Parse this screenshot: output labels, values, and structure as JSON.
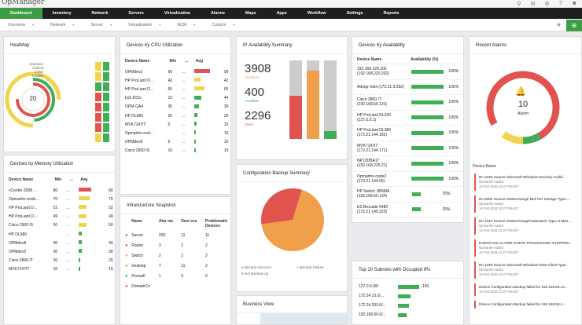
{
  "app": {
    "logo": "OpManager"
  },
  "nav": {
    "items": [
      "Dashboard",
      "Inventory",
      "Network",
      "Servers",
      "Virtualization",
      "Alarms",
      "Maps",
      "Apps",
      "Workflow",
      "Settings",
      "Reports"
    ],
    "active": 0
  },
  "subnav": {
    "items": [
      "Overview",
      "Network",
      "Server",
      "Virtualization",
      "NCM",
      "Custom"
    ]
  },
  "heatmap": {
    "title": "HeatMap",
    "legend": [
      "Attention",
      "Critical",
      "Clear",
      "Trouble"
    ],
    "center_value": "20"
  },
  "cpu": {
    "title": "Devices by CPU Utilization",
    "headers": [
      "Device Name",
      "Min",
      "...",
      "Avg"
    ],
    "rows": [
      {
        "name": "OPMdev2",
        "min": "99",
        "dot": "...",
        "avg": "99",
        "pct": 99,
        "color": "#e0534f"
      },
      {
        "name": "HP ProLiant D...",
        "min": "42",
        "dot": "...",
        "avg": "42",
        "pct": 42,
        "color": "#f0d44e"
      },
      {
        "name": "HP ProLiant D...",
        "min": "65",
        "dot": "...",
        "avg": "65",
        "pct": 65,
        "color": "#f0d44e"
      },
      {
        "name": "k16-DCtv",
        "min": "10",
        "dot": "...",
        "avg": "44",
        "pct": 44,
        "color": "#3fae57"
      },
      {
        "name": "OPM-QA4",
        "min": "30",
        "dot": "...",
        "avg": "30",
        "pct": 30,
        "color": "#3fae57"
      },
      {
        "name": "HP DL580",
        "min": "20",
        "dot": "...",
        "avg": "20",
        "pct": 20,
        "color": "#3fae57"
      },
      {
        "name": "MVK7147IT",
        "min": "5",
        "dot": "...",
        "avg": "15",
        "pct": 15,
        "color": "#3fae57"
      },
      {
        "name": "Opmanhv-nod...",
        "min": "",
        "dot": "...",
        "avg": "10",
        "pct": 10,
        "color": "#3fae57"
      },
      {
        "name": "OPMdev8",
        "min": "5",
        "dot": "...",
        "avg": "10",
        "pct": 10,
        "color": "#3fae57"
      },
      {
        "name": "Cisco 2900 IS",
        "min": "10",
        "dot": "...",
        "avg": "10",
        "pct": 10,
        "color": "#3fae57"
      }
    ]
  },
  "ipavail": {
    "title": "IP Availability Summary",
    "stats": [
      {
        "value": "3908",
        "label": "Transient",
        "color": "#f0a04b"
      },
      {
        "value": "400",
        "label": "Available",
        "color": "#3fae57"
      },
      {
        "value": "2296",
        "label": "Used",
        "color": "#e0534f"
      }
    ],
    "bars": [
      {
        "total": 100,
        "fill": 55,
        "color": "#e0534f"
      },
      {
        "total": 100,
        "fill": 87,
        "color": "#f0a04b"
      },
      {
        "total": 100,
        "fill": 10,
        "color": "#3fae57"
      }
    ]
  },
  "availability": {
    "title": "Devices by Availability",
    "headers": [
      "Device Name",
      "Availability (%)"
    ],
    "rows": [
      {
        "name": "192.168.220.202",
        "sub": "(192.168.220.202)",
        "value": "100%",
        "pct": 100
      },
      {
        "name": "Admgr-mbx (172.21.9.252)",
        "sub": "",
        "value": "100%",
        "pct": 100
      },
      {
        "name": "Cisco 2800 IT",
        "sub": "(192.168.50.131)",
        "value": "100%",
        "pct": 100
      },
      {
        "name": "HP ProLiant DL325",
        "sub": "(127.0.0.1)",
        "value": "100%",
        "pct": 100
      },
      {
        "name": "HP ProLiant DL380",
        "sub": "(172.21.144.182)",
        "value": "100%",
        "pct": 100
      },
      {
        "name": "MVK7147IT",
        "sub": "(172.21.144.171)",
        "value": "100%",
        "pct": 100
      },
      {
        "name": "NP12DBA17",
        "sub": "(192.168.225.21)",
        "value": "100%",
        "pct": 100
      },
      {
        "name": "Opmanhv-node2",
        "sub": "(172.21.144.65)",
        "value": "100%",
        "pct": 100
      },
      {
        "name": "HP Switch J8698A",
        "sub": "(192.168.50.134)",
        "value": "25%",
        "pct": 25
      },
      {
        "name": "ES Brocade 5480",
        "sub": "(172.21.149.223)",
        "value": "25%",
        "pct": 25
      }
    ]
  },
  "alarms": {
    "title": "Recent Alarms",
    "count": "10",
    "label": "Alarm",
    "col": "Device Name",
    "items": [
      {
        "title": "ID=4425 Source=Microsoft-Windows-Security-Auditi...",
        "src": "Opmanhv-node2",
        "date": "14 Feb 2019 12:27 PM IST"
      },
      {
        "title": "ID=6002 Source=MSExchange Mid-Tier Storage Type=...",
        "src": "Opmanhv-node2",
        "date": "14 Feb 2019 12:27 PM IST"
      },
      {
        "title": "ID=1010 Source=MSExchangeFastSearch Type=2 Mes...",
        "src": "Opmanhv-node2",
        "date": "14 Feb 2019 12:27 PM IST"
      },
      {
        "title": "EVENTLOG ALARM: EVENT PROCESSING STOPPED...",
        "src": "Opmanhv-node2",
        "date": "14 Feb 2019 12:27 PM IST"
      },
      {
        "title": "ID=1054 Source=Microsoft-Windows-DNS-Client Type...",
        "src": "Opmanhv-node2",
        "date": "14 Feb 2019 12:27 PM IST"
      },
      {
        "title": "Device Configuration Backup failed for 192.168.50.14...",
        "src": "",
        "date": "14 Feb 2019 12:27 PM IST"
      },
      {
        "title": "Device Configuration Backup failed for 192.168.50.4...",
        "src": "",
        "date": ""
      }
    ]
  },
  "memory": {
    "title": "Devices by Memory Utilization",
    "headers": [
      "Device Name",
      "Min",
      "...",
      "Avg"
    ],
    "rows": [
      {
        "name": "vCenter 2008 ...",
        "min": "80",
        "dot": "...",
        "avg": "80",
        "pct": 80,
        "color": "#e0534f"
      },
      {
        "name": "Opmanhv-node...",
        "min": "70",
        "dot": "...",
        "avg": "70",
        "pct": 70,
        "color": "#f0d44e"
      },
      {
        "name": "HP ProLiant D...",
        "min": "52",
        "dot": "...",
        "avg": "52",
        "pct": 52,
        "color": "#f0d44e"
      },
      {
        "name": "HP ProLiant D...",
        "min": "49",
        "dot": "...",
        "avg": "49",
        "pct": 49,
        "color": "#f0d44e"
      },
      {
        "name": "Cisco 2900 IS",
        "min": "50",
        "dot": "...",
        "avg": "50",
        "pct": 50,
        "color": "#f0d44e"
      },
      {
        "name": "HP DL580",
        "min": "",
        "dot": "...",
        "avg": "",
        "pct": 20,
        "color": "#3fae57"
      },
      {
        "name": "OPMdev8",
        "min": "40",
        "dot": "...",
        "avg": "40",
        "pct": 20,
        "color": "#3fae57"
      },
      {
        "name": "OPMdev2",
        "min": "30",
        "dot": "...",
        "avg": "30",
        "pct": 20,
        "color": "#3fae57"
      },
      {
        "name": "Cisco 2800 IT",
        "min": "20",
        "dot": "...",
        "avg": "20",
        "pct": 12,
        "color": "#3fae57"
      },
      {
        "name": "MVK7147IT",
        "min": "10",
        "dot": "...",
        "avg": "10",
        "pct": 10,
        "color": "#3fae57"
      }
    ]
  },
  "infra": {
    "title": "Infrastructure Snapshot",
    "headers": [
      "Name",
      "Alar ms",
      "Devi ces",
      "Problematic Devices"
    ],
    "rows": [
      {
        "name": "Server",
        "alarms": "209",
        "devices": "11",
        "problem": "11",
        "color": "#e0534f"
      },
      {
        "name": "Router",
        "alarms": "3",
        "devices": "2",
        "problem": "2",
        "color": "#e0534f"
      },
      {
        "name": "Switch",
        "alarms": "2",
        "devices": "2",
        "problem": "2",
        "color": "#f0a04b"
      },
      {
        "name": "Desktop",
        "alarms": "7",
        "devices": "11",
        "problem": "2",
        "color": "#f0a04b"
      },
      {
        "name": "Firewall",
        "alarms": "1",
        "devices": "0",
        "problem": "0",
        "color": "#3fae57"
      },
      {
        "name": "DomainCo",
        "alarms": "",
        "devices": "",
        "problem": "",
        "color": "#e0534f"
      }
    ]
  },
  "config": {
    "title": "Configuration Backup Summary",
    "legend": [
      {
        "label": "BackUp Success",
        "color": "#3fae57"
      },
      {
        "label": "BackUp Failure",
        "color": "#f0a04b"
      },
      {
        "label": "Not Backed Up",
        "color": "#e0534f"
      }
    ],
    "chart_data": {
      "type": "pie",
      "slices": [
        {
          "label": "BackUp Failure",
          "value": 68
        },
        {
          "label": "Not Backed Up",
          "value": 32
        },
        {
          "label": "BackUp Success",
          "value": 0
        }
      ]
    }
  },
  "subnets": {
    "title": "Top 10 Subnets with Occupied IPs",
    "rows": [
      {
        "name": "127.0.0.0/0",
        "value": "100",
        "pct": 100
      },
      {
        "name": "172.24.15.0/...",
        "value": "",
        "pct": 60
      },
      {
        "name": "172.24.253.0/...",
        "value": "",
        "pct": 50
      },
      {
        "name": "192.168.50.0/...",
        "value": "",
        "pct": 40
      }
    ]
  },
  "business": {
    "title": "Business View"
  }
}
